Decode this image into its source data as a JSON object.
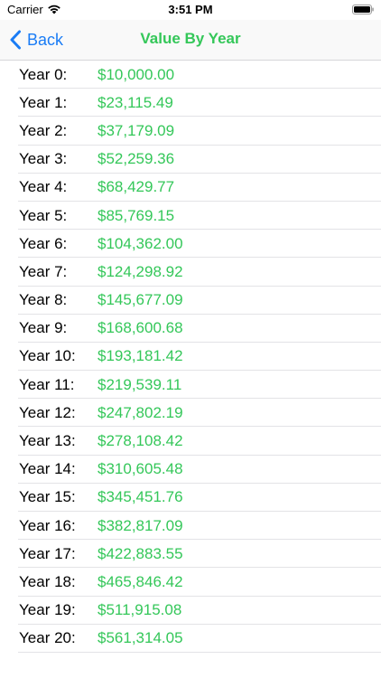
{
  "status_bar": {
    "carrier": "Carrier",
    "time": "3:51 PM"
  },
  "nav": {
    "back_label": "Back",
    "title": "Value By Year"
  },
  "colors": {
    "accent_blue": "#1a7cf5",
    "value_green": "#34c759"
  },
  "rows": [
    {
      "year": "Year 0:",
      "value": "$10,000.00"
    },
    {
      "year": "Year 1:",
      "value": "$23,115.49"
    },
    {
      "year": "Year 2:",
      "value": "$37,179.09"
    },
    {
      "year": "Year 3:",
      "value": "$52,259.36"
    },
    {
      "year": "Year 4:",
      "value": "$68,429.77"
    },
    {
      "year": "Year 5:",
      "value": "$85,769.15"
    },
    {
      "year": "Year 6:",
      "value": "$104,362.00"
    },
    {
      "year": "Year 7:",
      "value": "$124,298.92"
    },
    {
      "year": "Year 8:",
      "value": "$145,677.09"
    },
    {
      "year": "Year 9:",
      "value": "$168,600.68"
    },
    {
      "year": "Year 10:",
      "value": "$193,181.42"
    },
    {
      "year": "Year 11:",
      "value": "$219,539.11"
    },
    {
      "year": "Year 12:",
      "value": "$247,802.19"
    },
    {
      "year": "Year 13:",
      "value": "$278,108.42"
    },
    {
      "year": "Year 14:",
      "value": "$310,605.48"
    },
    {
      "year": "Year 15:",
      "value": "$345,451.76"
    },
    {
      "year": "Year 16:",
      "value": "$382,817.09"
    },
    {
      "year": "Year 17:",
      "value": "$422,883.55"
    },
    {
      "year": "Year 18:",
      "value": "$465,846.42"
    },
    {
      "year": "Year 19:",
      "value": "$511,915.08"
    },
    {
      "year": "Year 20:",
      "value": "$561,314.05"
    }
  ]
}
